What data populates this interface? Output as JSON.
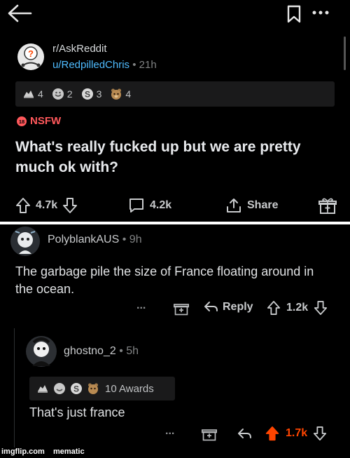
{
  "post": {
    "subreddit": "r/AskReddit",
    "author": "u/RedpilledChris",
    "age": "21h",
    "awards": [
      {
        "icon": "wholesome-award-icon",
        "count": "4"
      },
      {
        "icon": "silver-award-icon",
        "count": "2"
      },
      {
        "icon": "gold-award-icon",
        "count": "3"
      },
      {
        "icon": "bear-award-icon",
        "count": "4"
      }
    ],
    "nsfw_label": "NSFW",
    "title": "What's really fucked up but we are pretty much ok with?",
    "votes": "4.7k",
    "comments": "4.2k",
    "share_label": "Share"
  },
  "comment1": {
    "author": "PolyblankAUS",
    "age": "9h",
    "text": "The garbage pile the size of France floating around in the ocean.",
    "reply_label": "Reply",
    "votes": "1.2k",
    "more_label": "..."
  },
  "comment2": {
    "author": "ghostno_2",
    "age": "5h",
    "awards_label": "10 Awards",
    "text": "That's just france",
    "votes": "1.7k",
    "more_label": "..."
  },
  "separator": "•",
  "watermark": "imgflip.com    mematic",
  "colors": {
    "background": "#000000",
    "username": "#4fbcff",
    "nsfw": "#ff585b",
    "upvote_active": "#ff4500"
  }
}
